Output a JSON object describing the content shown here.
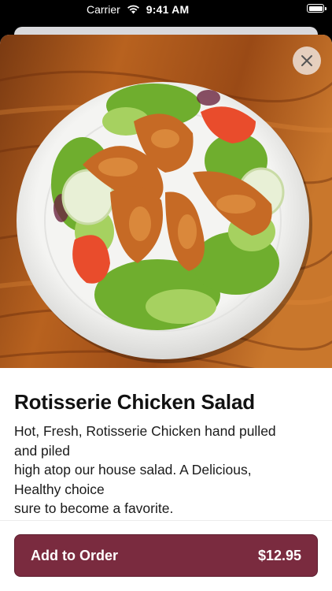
{
  "status_bar": {
    "carrier": "Carrier",
    "time": "9:41 AM"
  },
  "item": {
    "name": "Rotisserie Chicken Salad",
    "description_lines": [
      "Hot, Fresh, Rotisserie Chicken hand pulled",
      "and piled",
      "high atop our house salad. A Delicious,",
      "Healthy choice",
      "sure to become a favorite."
    ]
  },
  "order_button": {
    "label": "Add to Order",
    "price": "$12.95"
  },
  "colors": {
    "accent": "#7a2b3f",
    "text": "#111111"
  },
  "icons": {
    "close": "close-icon",
    "wifi": "wifi-icon",
    "battery": "battery-icon"
  }
}
